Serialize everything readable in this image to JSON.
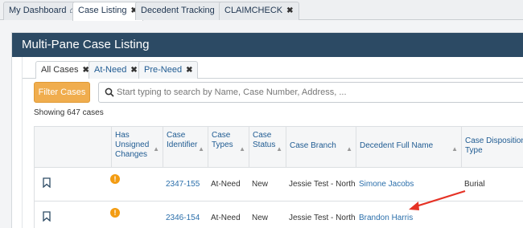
{
  "top_tabs": [
    {
      "label": "My Dashboard",
      "icon": "home-icon"
    },
    {
      "label": "Case Listing"
    },
    {
      "label": "Decedent Tracking"
    },
    {
      "label": "CLAIMCHECK"
    }
  ],
  "panel": {
    "title": "Multi-Pane Case Listing"
  },
  "sub_tabs": [
    {
      "label": "All Cases"
    },
    {
      "label": "At-Need"
    },
    {
      "label": "Pre-Need"
    }
  ],
  "filter": {
    "button_label": "Filter Cases",
    "search_placeholder": "Start typing to search by Name, Case Number, Address, ..."
  },
  "showing": "Showing 647 cases",
  "table": {
    "headers": [
      "Has Unsigned Changes",
      "Case Identifier",
      "Case Types",
      "Case Status",
      "Case Branch",
      "Decedent Full Name",
      "Case Disposition Type"
    ],
    "rows": [
      {
        "case_id": "2347-155",
        "type": "At-Need",
        "status": "New",
        "branch": "Jessie Test - North",
        "decedent": "Simone Jacobs",
        "disposition": "Burial"
      },
      {
        "case_id": "2346-154",
        "type": "At-Need",
        "status": "New",
        "branch": "Jessie Test - North",
        "decedent": "Brandon Harris",
        "disposition": ""
      }
    ]
  },
  "colors": {
    "header_bg": "#2c4a64",
    "accent": "#f0ad4e",
    "link": "#2b6fab",
    "warn": "#f39c12",
    "arrow": "#e53225"
  }
}
